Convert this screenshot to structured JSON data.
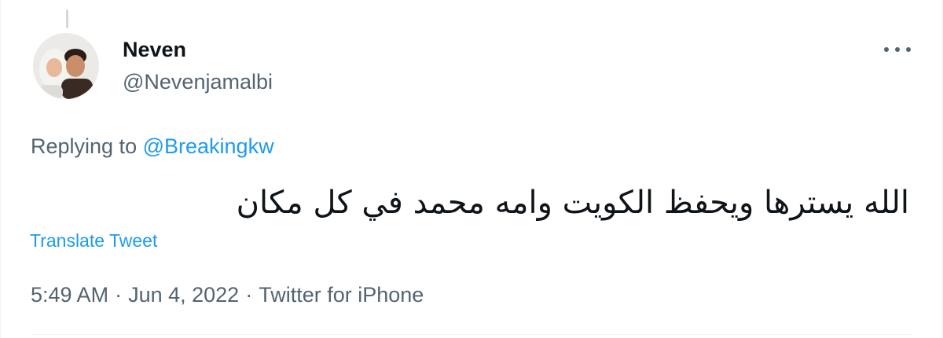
{
  "tweet": {
    "author": {
      "display_name": "Neven",
      "handle": "@Nevenjamalbi"
    },
    "replying_prefix": "Replying to ",
    "replying_to": "@Breakingkw",
    "text": "الله يسترها ويحفظ الكويت وامه محمد في كل مكان",
    "translate_label": "Translate Tweet",
    "time": "5:49 AM",
    "date": "Jun 4, 2022",
    "source": "Twitter for iPhone",
    "separator": "·"
  },
  "icons": {
    "more": "more-horizontal-icon",
    "avatar": "profile-avatar"
  },
  "colors": {
    "link": "#1d9bf0",
    "secondary_text": "#536471",
    "primary_text": "#0f1419"
  }
}
